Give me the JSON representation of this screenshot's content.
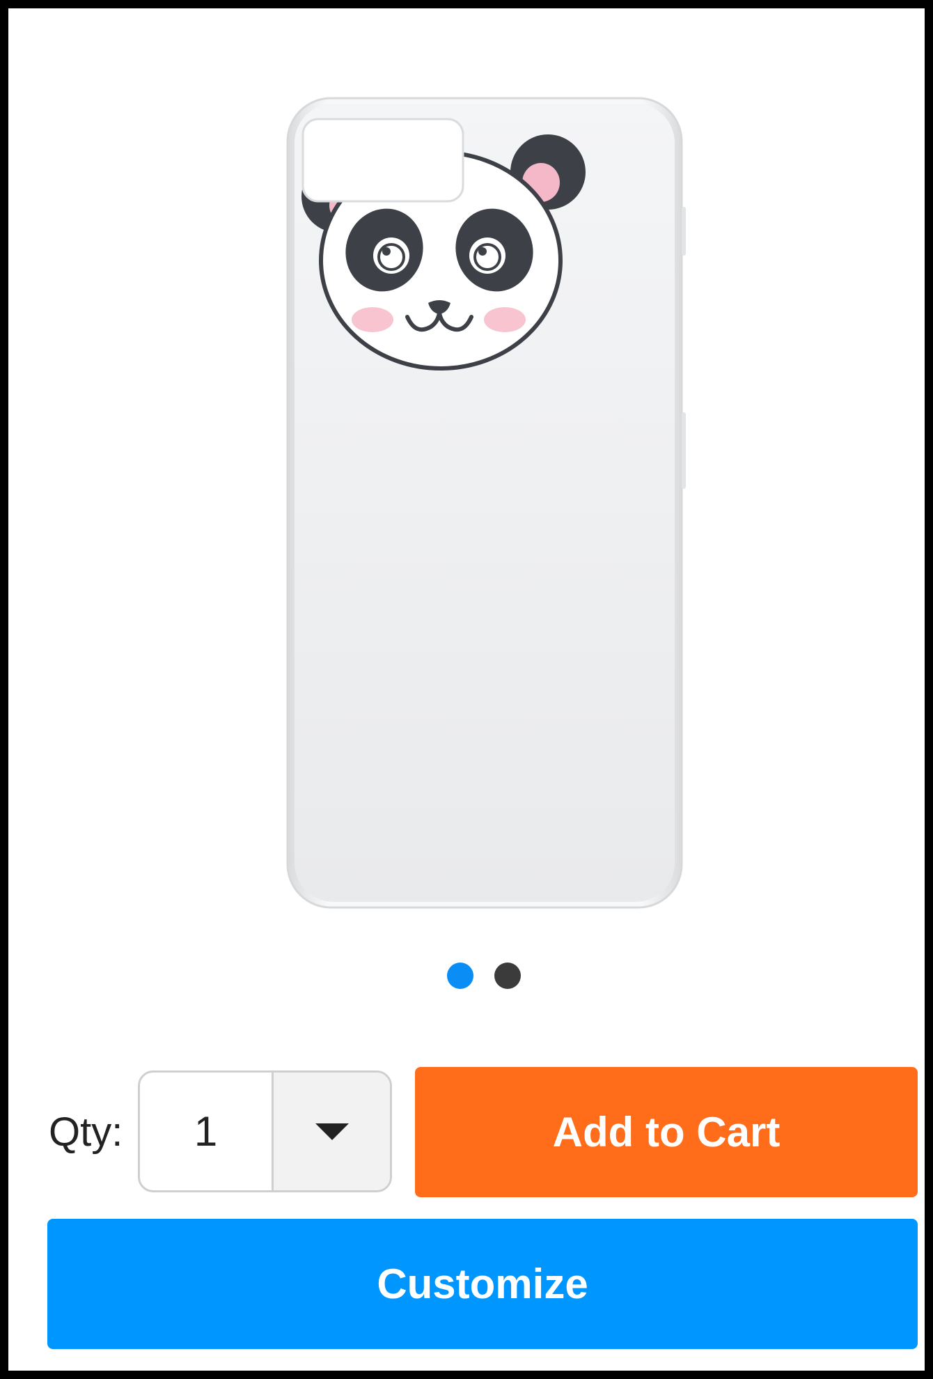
{
  "product": {
    "image_icon": "panda-phone-case-image",
    "carousel": {
      "active_color": "#0a8ef5",
      "inactive_color": "#3b3b3b",
      "dots": [
        {
          "state": "active"
        },
        {
          "state": "inactive"
        }
      ]
    }
  },
  "purchase": {
    "qty_label": "Qty:",
    "qty_value": "1",
    "add_to_cart_label": "Add to Cart",
    "add_to_cart_color": "#ff6d1b"
  },
  "customize": {
    "label": "Customize",
    "color": "#0096ff"
  }
}
